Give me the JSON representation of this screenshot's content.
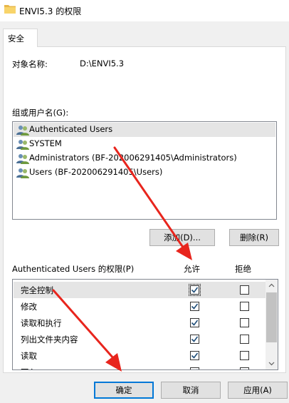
{
  "window": {
    "title": "ENVI5.3 的权限"
  },
  "tabs": [
    {
      "label": "安全"
    }
  ],
  "object": {
    "label": "对象名称:",
    "value": "D:\\ENVI5.3"
  },
  "groups": {
    "label": "组或用户名(G):",
    "users": [
      {
        "name": "Authenticated Users"
      },
      {
        "name": "SYSTEM"
      },
      {
        "name": "Administrators (BF-202006291405\\Administrators)"
      },
      {
        "name": "Users (BF-202006291405\\Users)"
      }
    ],
    "selected_index": 0
  },
  "buttons": {
    "add": "添加(D)...",
    "remove": "删除(R)",
    "ok": "确定",
    "cancel": "取消",
    "apply": "应用(A)"
  },
  "permissions": {
    "label": "Authenticated Users 的权限(P)",
    "allow_header": "允许",
    "deny_header": "拒绝",
    "rows": [
      {
        "name": "完全控制",
        "allow": true,
        "deny": false
      },
      {
        "name": "修改",
        "allow": true,
        "deny": false
      },
      {
        "name": "读取和执行",
        "allow": true,
        "deny": false
      },
      {
        "name": "列出文件夹内容",
        "allow": true,
        "deny": false
      },
      {
        "name": "读取",
        "allow": true,
        "deny": false
      },
      {
        "name": "写入",
        "allow": true,
        "deny": false
      }
    ]
  },
  "colors": {
    "annotation_arrow": "#e8251d",
    "checkmark": "#1f4e79",
    "selection": "#e5e5e5"
  }
}
